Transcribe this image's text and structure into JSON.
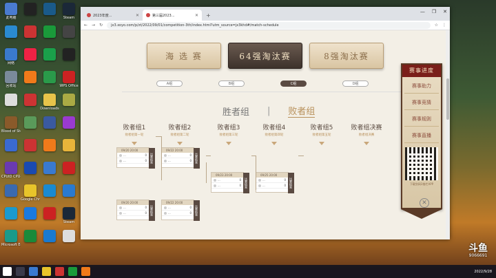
{
  "desktop": {
    "icons": [
      {
        "label": "此电脑",
        "color": "#4a7bd0"
      },
      {
        "label": "",
        "color": "#222"
      },
      {
        "label": "",
        "color": "#1a5a8a"
      },
      {
        "label": "Steam",
        "color": "#1b2838"
      },
      {
        "label": "",
        "color": "#2a8ad0"
      },
      {
        "label": "",
        "color": "#c33"
      },
      {
        "label": "",
        "color": "#1a9a3a"
      },
      {
        "label": "",
        "color": "#444"
      },
      {
        "label": "网络",
        "color": "#3a7acd"
      },
      {
        "label": "",
        "color": "#e24"
      },
      {
        "label": "",
        "color": "#1aa04a"
      },
      {
        "label": "",
        "color": "#222"
      },
      {
        "label": "回收站",
        "color": "#7a8a9a"
      },
      {
        "label": "",
        "color": "#f07a1a"
      },
      {
        "label": "",
        "color": "#2a9a4a"
      },
      {
        "label": "WPS Office",
        "color": "#c22"
      },
      {
        "label": "",
        "color": "#ddd"
      },
      {
        "label": "",
        "color": "#c33"
      },
      {
        "label": "Downloads",
        "color": "#e8c44a"
      },
      {
        "label": "",
        "color": "#aa4"
      },
      {
        "label": "Blood of Steel",
        "color": "#8a5a2a"
      },
      {
        "label": "",
        "color": "#5a9a5a"
      },
      {
        "label": "",
        "color": "#3a5aa0"
      },
      {
        "label": "",
        "color": "#9a3ad0"
      },
      {
        "label": "",
        "color": "#3a6ad0"
      },
      {
        "label": "",
        "color": "#c33"
      },
      {
        "label": "",
        "color": "#f07a1a"
      },
      {
        "label": "",
        "color": "#e8b43a"
      },
      {
        "label": "CPUID CPU-Z",
        "color": "#6a3ab0"
      },
      {
        "label": "",
        "color": "#1a4ab0"
      },
      {
        "label": "",
        "color": "#3a7ad0"
      },
      {
        "label": "",
        "color": "#c22"
      },
      {
        "label": "",
        "color": "#3a6ab0"
      },
      {
        "label": "Google Chrome",
        "color": "#e8c42a"
      },
      {
        "label": "",
        "color": "#1a8ad0"
      },
      {
        "label": "",
        "color": "#2a7ad0"
      },
      {
        "label": "",
        "color": "#1a9ad0"
      },
      {
        "label": "",
        "color": "#1a7ae0"
      },
      {
        "label": "",
        "color": "#c22"
      },
      {
        "label": "Steam",
        "color": "#1b2838"
      },
      {
        "label": "Microsoft Edge",
        "color": "#1a9a8a"
      },
      {
        "label": "",
        "color": "#1a8a3a"
      },
      {
        "label": "",
        "color": "#1a7ad0"
      },
      {
        "label": "",
        "color": "#ddd"
      }
    ]
  },
  "browser": {
    "tabs": [
      {
        "label": "2023年度...",
        "active": false
      },
      {
        "label": "第三届2023...",
        "active": true
      }
    ],
    "url": "jx3.xoyo.com/p/zt/2022/09/01/competition-3th/index.html?utm_source=jx3khd#/match-schedule",
    "window_controls": [
      "—",
      "❐",
      "✕"
    ]
  },
  "page": {
    "stages": [
      {
        "label": "海 选 赛",
        "active": false
      },
      {
        "label": "64强淘汰赛",
        "active": true
      },
      {
        "label": "8强淘汰赛",
        "active": false
      }
    ],
    "groups": [
      {
        "label": "A组",
        "active": false
      },
      {
        "label": "B组",
        "active": false
      },
      {
        "label": "C组",
        "active": true
      },
      {
        "label": "D组",
        "active": false
      }
    ],
    "brackets": {
      "winners": "胜者组",
      "separator": "|",
      "losers": "败者组"
    },
    "rounds": [
      {
        "title": "败者组1",
        "desc": "败者组第一轮"
      },
      {
        "title": "败者组2",
        "desc": "败者组第二轮"
      },
      {
        "title": "败者组3",
        "desc": "败者组第三轮"
      },
      {
        "title": "败者组4",
        "desc": "败者组第四轮"
      },
      {
        "title": "败者组5",
        "desc": "败者组第五轮"
      },
      {
        "title": "败者组决赛",
        "desc": "败者组决赛"
      }
    ],
    "matches": [
      {
        "time": "09/20 20:00",
        "a": "...",
        "b": "...",
        "sa": "0",
        "sb": "0",
        "label": "比赛结束"
      },
      {
        "time": "09/22 20:00",
        "a": "...",
        "b": "...",
        "sa": "0",
        "sb": "0",
        "label": "比赛结束"
      },
      {
        "time": "09/23 20:00",
        "a": "...",
        "b": "...",
        "sa": "0",
        "sb": "0",
        "label": "比赛结束"
      },
      {
        "time": "09/25 20:00",
        "a": "...",
        "b": "...",
        "sa": "0",
        "sb": "0",
        "label": "比赛结束"
      },
      {
        "time": "09/20 20:00",
        "a": "...",
        "b": "...",
        "sa": "0",
        "sb": "0",
        "label": "比赛结束"
      },
      {
        "time": "09/22 20:00",
        "a": "...",
        "b": "...",
        "sa": "0",
        "sb": "0",
        "label": "比赛结束"
      }
    ],
    "sidebar": {
      "header": "赛事进度",
      "items": [
        "赛事助力",
        "赛事竞猜",
        "赛事规则",
        "赛事直播"
      ],
      "footer": "下载剑网3推栏APP"
    }
  },
  "taskbar": {
    "time": "",
    "date": "2022/9/28"
  },
  "watermark": {
    "brand": "斗鱼",
    "id": "9066691"
  }
}
